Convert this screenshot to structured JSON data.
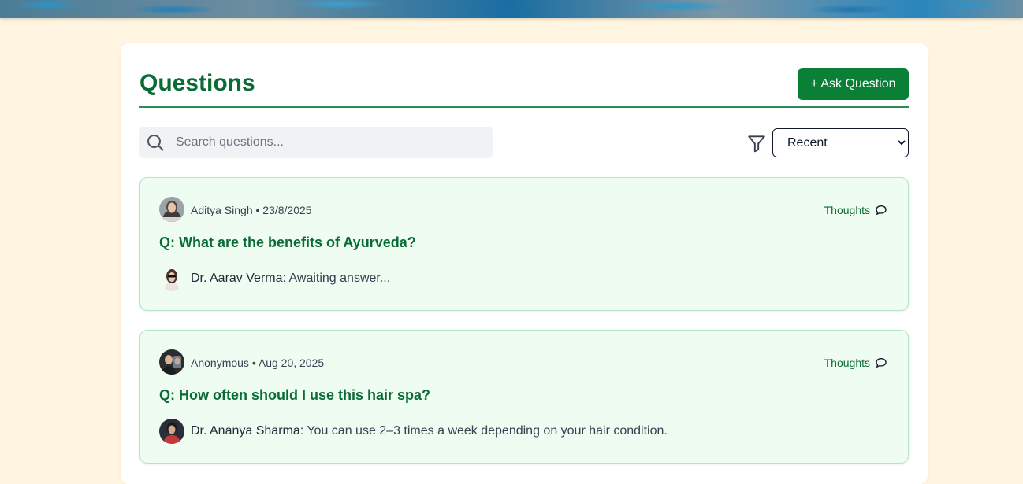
{
  "header": {
    "title": "Questions",
    "ask_button_label": "+ Ask Question"
  },
  "search": {
    "placeholder": "Search questions...",
    "value": ""
  },
  "sort": {
    "selected": "Recent"
  },
  "questions": [
    {
      "author": "Aditya Singh",
      "separator": "•",
      "date": "23/8/2025",
      "thoughts_label": "Thoughts",
      "title": "Q: What are the benefits of Ayurveda?",
      "answer_doctor": "Dr. Aarav Verma",
      "answer_text": ": Awaiting answer..."
    },
    {
      "author": "Anonymous",
      "separator": "•",
      "date": "Aug 20, 2025",
      "thoughts_label": "Thoughts",
      "title": "Q: How often should I use this hair spa?",
      "answer_doctor": "Dr. Ananya Sharma",
      "answer_text": ": You can use 2–3 times a week depending on your hair condition."
    }
  ],
  "colors": {
    "background": "#fff5e0",
    "accent": "#0a7f36",
    "card_bg": "#eefcf1",
    "card_border": "#b7e4c4"
  },
  "icons": [
    "search-icon",
    "filter-icon",
    "chat-bubble-icon",
    "user-avatar"
  ]
}
